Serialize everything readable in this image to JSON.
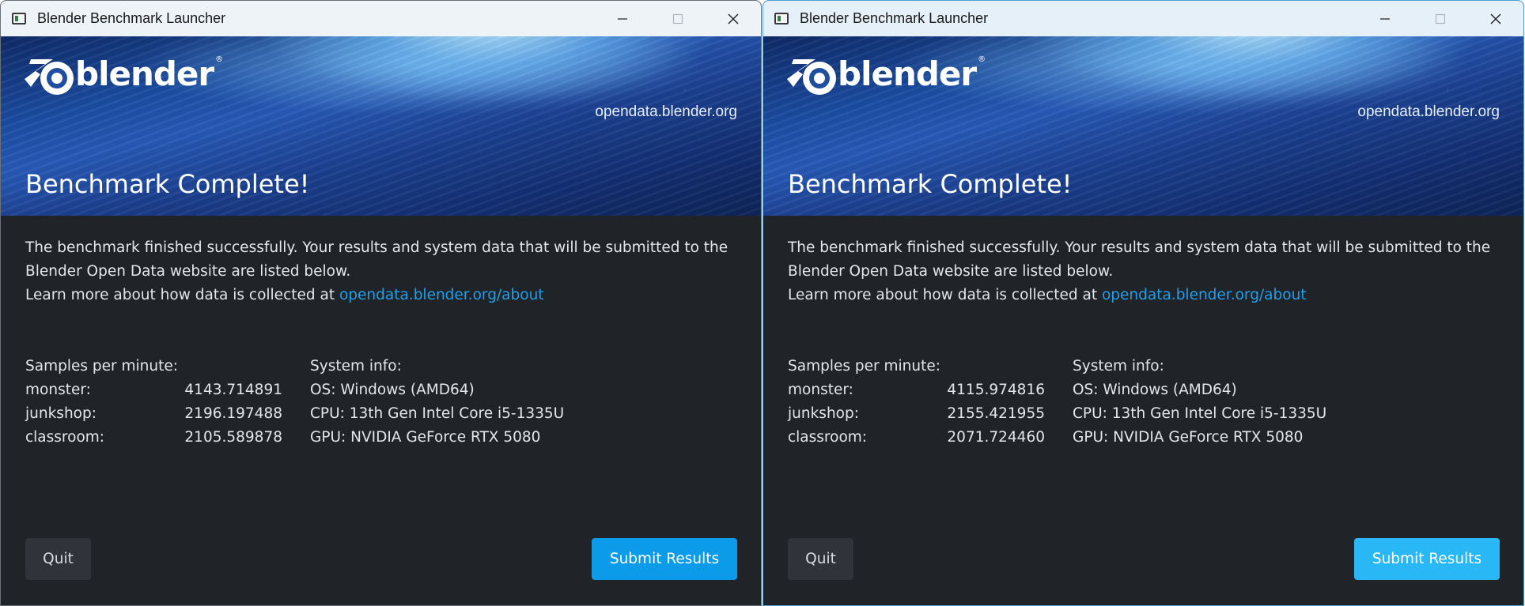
{
  "windows": [
    {
      "title": "Blender Benchmark Launcher",
      "logo_text": "blender",
      "site_link": "opendata.blender.org",
      "headline": "Benchmark Complete!",
      "intro_line1": "The benchmark finished successfully. Your results and system data that will be submitted to the",
      "intro_line2": "Blender Open Data website are listed below.",
      "intro_line3_prefix": "Learn more about how data is collected at ",
      "intro_link": "opendata.blender.org/about",
      "samples_header": "Samples per minute:",
      "scenes": [
        {
          "name": "monster:",
          "value": "4143.714891"
        },
        {
          "name": "junkshop:",
          "value": "2196.197488"
        },
        {
          "name": "classroom:",
          "value": "2105.589878"
        }
      ],
      "system_header": "System info:",
      "system": [
        "OS: Windows (AMD64)",
        "CPU: 13th Gen Intel Core i5-1335U",
        "GPU: NVIDIA GeForce RTX 5080"
      ],
      "quit_label": "Quit",
      "submit_label": "Submit Results"
    },
    {
      "title": "Blender Benchmark Launcher",
      "logo_text": "blender",
      "site_link": "opendata.blender.org",
      "headline": "Benchmark Complete!",
      "intro_line1": "The benchmark finished successfully. Your results and system data that will be submitted to the",
      "intro_line2": "Blender Open Data website are listed below.",
      "intro_line3_prefix": "Learn more about how data is collected at ",
      "intro_link": "opendata.blender.org/about",
      "samples_header": "Samples per minute:",
      "scenes": [
        {
          "name": "monster:",
          "value": "4115.974816"
        },
        {
          "name": "junkshop:",
          "value": "2155.421955"
        },
        {
          "name": "classroom:",
          "value": "2071.724460"
        }
      ],
      "system_header": "System info:",
      "system": [
        "OS: Windows (AMD64)",
        "CPU: 13th Gen Intel Core i5-1335U",
        "GPU: NVIDIA GeForce RTX 5080"
      ],
      "quit_label": "Quit",
      "submit_label": "Submit Results"
    }
  ],
  "colors": {
    "accent_link": "#1ea0ea",
    "submit_button": "#0b9be8",
    "window_bg": "#202328"
  },
  "icons": {
    "app": "window-app-icon",
    "minimize": "minimize-icon",
    "maximize": "maximize-icon",
    "close": "close-icon",
    "logo": "blender-logo-icon"
  }
}
